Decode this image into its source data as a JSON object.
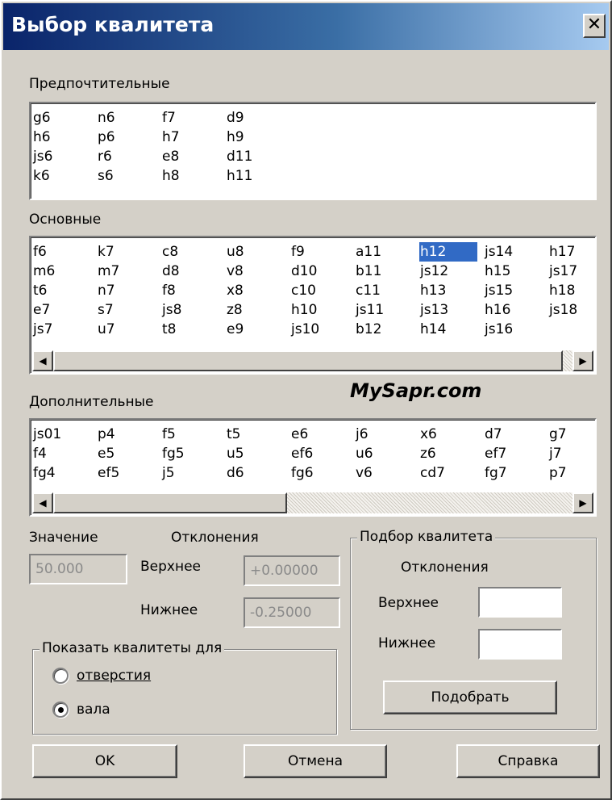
{
  "window": {
    "title": "Выбор квалитета",
    "close_glyph": "✕"
  },
  "preferred": {
    "label": "Предпочтительные",
    "rows": 4,
    "items": [
      "g6",
      "h6",
      "js6",
      "k6",
      "n6",
      "p6",
      "r6",
      "s6",
      "f7",
      "h7",
      "e8",
      "h8",
      "d9",
      "h9",
      "d11",
      "h11"
    ]
  },
  "main": {
    "label": "Основные",
    "rows": 5,
    "selected": "h12",
    "items": [
      "f6",
      "m6",
      "t6",
      "e7",
      "js7",
      "k7",
      "m7",
      "n7",
      "s7",
      "u7",
      "c8",
      "d8",
      "f8",
      "js8",
      "t8",
      "u8",
      "v8",
      "x8",
      "z8",
      "e9",
      "f9",
      "d10",
      "c10",
      "h10",
      "js10",
      "a11",
      "b11",
      "c11",
      "js11",
      "b12",
      "h12",
      "js12",
      "h13",
      "js13",
      "h14",
      "js14",
      "h15",
      "js15",
      "h16",
      "js16",
      "h17",
      "js17",
      "h18",
      "js18"
    ]
  },
  "additional": {
    "label": "Дополнительные",
    "rows": 3,
    "items": [
      "js01",
      "f4",
      "fg4",
      "p4",
      "e5",
      "ef5",
      "f5",
      "fg5",
      "j5",
      "t5",
      "u5",
      "d6",
      "e6",
      "ef6",
      "fg6",
      "j6",
      "u6",
      "v6",
      "x6",
      "z6",
      "cd7",
      "d7",
      "ef7",
      "fg7",
      "g7",
      "j7",
      "p7"
    ]
  },
  "value": {
    "label": "Значение",
    "value": "50.000"
  },
  "deviations": {
    "label": "Отклонения",
    "upper_label": "Верхнее",
    "upper_value": "+0.00000",
    "lower_label": "Нижнее",
    "lower_value": "-0.25000"
  },
  "show_for": {
    "label": "Показать квалитеты для",
    "options": [
      {
        "label": "отверстия",
        "checked": false
      },
      {
        "label": "вала",
        "checked": true
      }
    ]
  },
  "selection": {
    "label": "Подбор квалитета",
    "deviations_label": "Отклонения",
    "upper_label": "Верхнее",
    "upper_value": "",
    "lower_label": "Нижнее",
    "lower_value": "",
    "button": "Подобрать"
  },
  "buttons": {
    "ok": "OK",
    "cancel": "Отмена",
    "help": "Справка"
  },
  "scroll_arrows": {
    "left": "◀",
    "right": "▶"
  },
  "watermark": "MySapr.com"
}
